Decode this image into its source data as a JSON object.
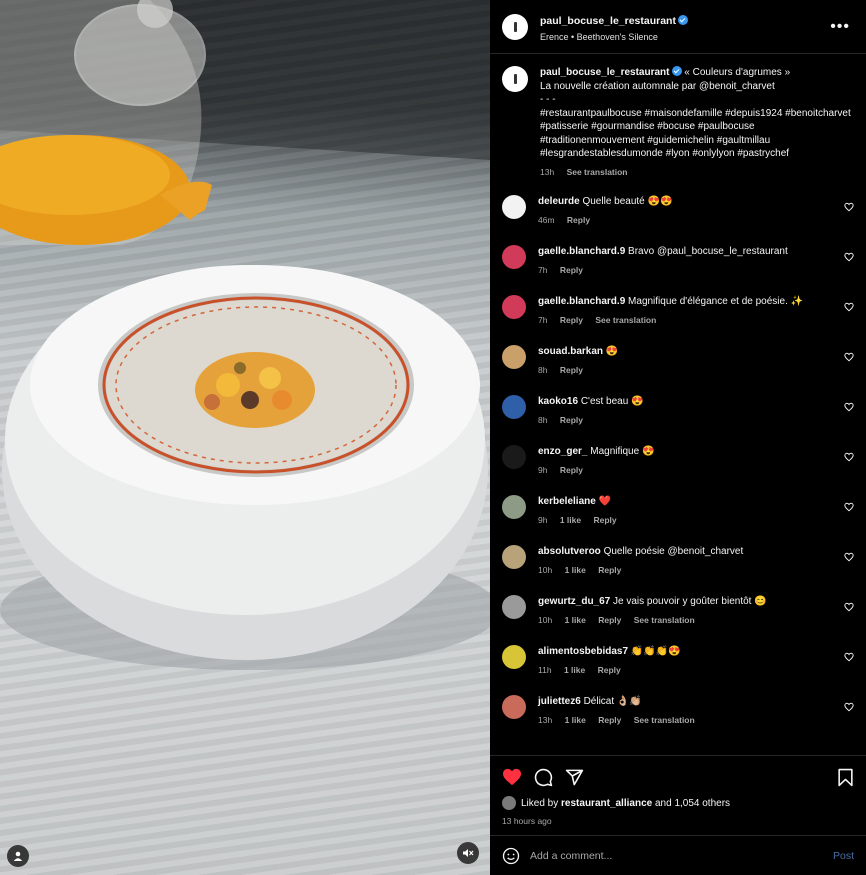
{
  "post": {
    "username": "paul_bocuse_le_restaurant",
    "audio": "Erence • Beethoven's Silence",
    "caption": {
      "quote": "« Couleurs d'agrumes »",
      "line2": "La nouvelle création automnale par @benoit_charvet",
      "dashes": "- - -",
      "hashtags": "#restaurantpaulbocuse #maisondefamille #depuis1924 #benoitcharvet #patisserie #gourmandise #bocuse #paulbocuse #traditionenmouvement #guidemichelin #gaultmillau #lesgrandestablesdumonde #lyon #onlylyon #pastrychef",
      "time": "13h",
      "see_translation": "See translation"
    }
  },
  "comments": [
    {
      "user": "deleurde",
      "text": "Quelle beauté 😍😍",
      "time": "46m",
      "likes": "",
      "reply": "Reply",
      "translate": "",
      "avatar_color": "#f2f2f2"
    },
    {
      "user": "gaelle.blanchard.9",
      "text": "Bravo @paul_bocuse_le_restaurant",
      "time": "7h",
      "likes": "",
      "reply": "Reply",
      "translate": "",
      "avatar_color": "#d23a5a"
    },
    {
      "user": "gaelle.blanchard.9",
      "text": "Magnifique d'élégance et de poésie. ✨",
      "time": "7h",
      "likes": "",
      "reply": "Reply",
      "translate": "See translation",
      "avatar_color": "#d23a5a"
    },
    {
      "user": "souad.barkan",
      "text": "😍",
      "time": "8h",
      "likes": "",
      "reply": "Reply",
      "translate": "",
      "avatar_color": "#c9a06a"
    },
    {
      "user": "kaoko16",
      "text": "C'est beau 😍",
      "time": "8h",
      "likes": "",
      "reply": "Reply",
      "translate": "",
      "avatar_color": "#2e5fa8"
    },
    {
      "user": "enzo_ger_",
      "text": "Magnifique 😍",
      "time": "9h",
      "likes": "",
      "reply": "Reply",
      "translate": "",
      "avatar_color": "#1a1a1a"
    },
    {
      "user": "kerbeleliane",
      "text": "❤️",
      "time": "9h",
      "likes": "1 like",
      "reply": "Reply",
      "translate": "",
      "avatar_color": "#8c9a86"
    },
    {
      "user": "absolutveroo",
      "text": "Quelle poésie @benoit_charvet",
      "time": "10h",
      "likes": "1 like",
      "reply": "Reply",
      "translate": "",
      "avatar_color": "#b7a27a"
    },
    {
      "user": "gewurtz_du_67",
      "text": "Je vais pouvoir y goûter bientôt 😊",
      "time": "10h",
      "likes": "1 like",
      "reply": "Reply",
      "translate": "See translation",
      "avatar_color": "#9a9a9a"
    },
    {
      "user": "alimentosbebidas7",
      "text": "👏👏👏😍",
      "time": "11h",
      "likes": "1 like",
      "reply": "Reply",
      "translate": "",
      "avatar_color": "#d8c437"
    },
    {
      "user": "juliettez6",
      "text": "Délicat 👌🏼👏🏼",
      "time": "13h",
      "likes": "1 like",
      "reply": "Reply",
      "translate": "See translation",
      "avatar_color": "#c96b5a"
    }
  ],
  "actions": {
    "liked_by_prefix": "Liked by",
    "liked_by_user": "restaurant_alliance",
    "liked_by_suffix": "and 1,054 others",
    "time_ago": "13 hours ago",
    "comment_placeholder": "Add a comment...",
    "post_label": "Post",
    "like_color": "#ff3040"
  },
  "icons": [
    "more-options-icon",
    "heart-icon",
    "comment-icon",
    "share-icon",
    "bookmark-icon",
    "emoji-icon",
    "tagged-user-icon",
    "audio-muted-icon"
  ]
}
